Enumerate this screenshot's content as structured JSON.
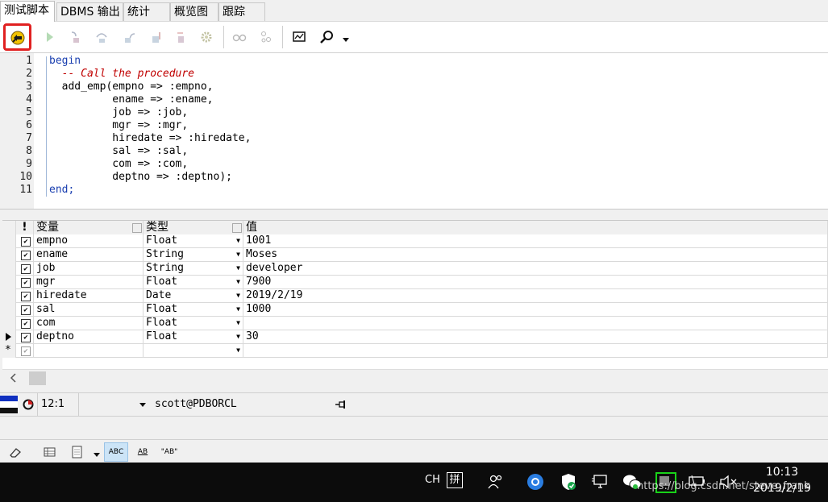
{
  "tabs": [
    {
      "label": "测试脚本",
      "active": true
    },
    {
      "label": "DBMS 输出",
      "active": false
    },
    {
      "label": "统计",
      "active": false
    },
    {
      "label": "概览图",
      "active": false
    },
    {
      "label": "跟踪",
      "active": false
    }
  ],
  "toolbar": {
    "buttons": [
      "execute-debug-icon",
      "run-icon",
      "step-into-icon",
      "step-over-icon",
      "step-out-icon",
      "run-to-exception-icon",
      "stop-icon",
      "settings-icon",
      "watch-icon",
      "breakpoints-icon",
      "screen-icon",
      "search-icon"
    ],
    "highlight_color": "#e02020"
  },
  "editor": {
    "line_numbers": [
      "1",
      "2",
      "3",
      "4",
      "5",
      "6",
      "7",
      "8",
      "9",
      "10",
      "11"
    ],
    "lines": [
      {
        "text": "begin",
        "style": "kw"
      },
      {
        "text": "  -- Call the procedure",
        "style": "cm"
      },
      {
        "text": "  add_emp(empno => :empno,",
        "style": "plain"
      },
      {
        "text": "          ename => :ename,",
        "style": "plain"
      },
      {
        "text": "          job => :job,",
        "style": "plain"
      },
      {
        "text": "          mgr => :mgr,",
        "style": "plain"
      },
      {
        "text": "          hiredate => :hiredate,",
        "style": "plain"
      },
      {
        "text": "          sal => :sal,",
        "style": "plain"
      },
      {
        "text": "          com => :com,",
        "style": "plain"
      },
      {
        "text": "          deptno => :deptno);",
        "style": "plain"
      },
      {
        "text": "end;",
        "style": "kw"
      }
    ]
  },
  "grid": {
    "headers": {
      "marker": "!",
      "variable": "变量",
      "type": "类型",
      "value": "值"
    },
    "rows": [
      {
        "name": "empno",
        "type": "Float",
        "value": "1001",
        "checked": true,
        "current": false
      },
      {
        "name": "ename",
        "type": "String",
        "value": "Moses",
        "checked": true,
        "current": false
      },
      {
        "name": "job",
        "type": "String",
        "value": "developer",
        "checked": true,
        "current": false
      },
      {
        "name": "mgr",
        "type": "Float",
        "value": "7900",
        "checked": true,
        "current": false
      },
      {
        "name": "hiredate",
        "type": "Date",
        "value": "2019/2/19",
        "checked": true,
        "current": false
      },
      {
        "name": "sal",
        "type": "Float",
        "value": "1000",
        "checked": true,
        "current": false
      },
      {
        "name": "com",
        "type": "Float",
        "value": "",
        "checked": true,
        "current": false
      },
      {
        "name": "deptno",
        "type": "Float",
        "value": "30",
        "checked": true,
        "current": true
      }
    ],
    "new_row_marker": "*"
  },
  "status": {
    "position": "12:1",
    "connection": "scott@PDBORCL"
  },
  "bottom_toolbar": {
    "abc_label": "ABC",
    "abc2_label": "AB",
    "quote_label": "\"AB\""
  },
  "taskbar": {
    "ime_lang": "CH",
    "ime_mode": "拼",
    "time": "10:13",
    "date": "2019/2/19",
    "watermark": "https://blog.csdn.net/steve_frank"
  }
}
